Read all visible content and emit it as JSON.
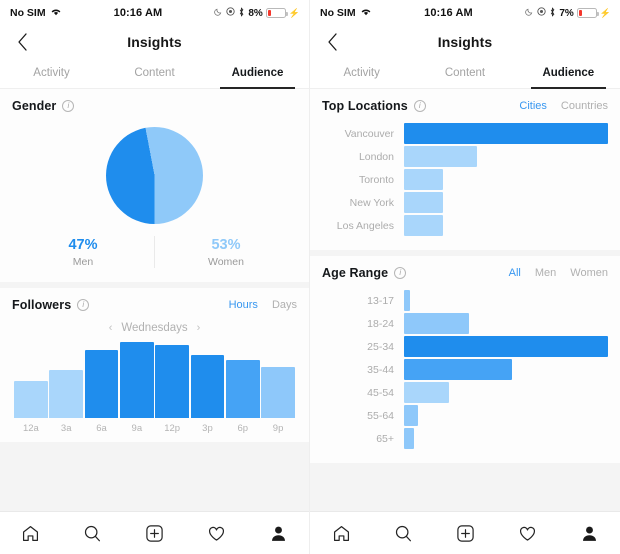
{
  "screens": [
    {
      "id": "left",
      "status": {
        "carrier": "No SIM",
        "wifi_icon": "wifi-icon",
        "time": "10:16 AM",
        "moon_icon": "moon-icon",
        "location_icon": "location-icon",
        "bluetooth_icon": "bluetooth-icon",
        "battery_percent": "8%",
        "charging_icon": "charging-bolt-icon"
      },
      "nav": {
        "back_icon": "back-chevron-icon",
        "title": "Insights"
      },
      "tabs": [
        {
          "label": "Activity",
          "active": false
        },
        {
          "label": "Content",
          "active": false
        },
        {
          "label": "Audience",
          "active": true
        }
      ],
      "cards": [
        "gender",
        "followers"
      ]
    },
    {
      "id": "right",
      "status": {
        "carrier": "No SIM",
        "wifi_icon": "wifi-icon",
        "time": "10:16 AM",
        "moon_icon": "moon-icon",
        "location_icon": "location-icon",
        "bluetooth_icon": "bluetooth-icon",
        "battery_percent": "7%",
        "charging_icon": "charging-bolt-icon"
      },
      "nav": {
        "back_icon": "back-chevron-icon",
        "title": "Insights"
      },
      "tabs": [
        {
          "label": "Activity",
          "active": false
        },
        {
          "label": "Content",
          "active": false
        },
        {
          "label": "Audience",
          "active": true
        }
      ],
      "cards": [
        "top_locations",
        "age_range"
      ]
    }
  ],
  "gender": {
    "title": "Gender",
    "info_icon": "info-icon",
    "men_pct": "47%",
    "men_label": "Men",
    "women_pct": "53%",
    "women_label": "Women"
  },
  "followers": {
    "title": "Followers",
    "info_icon": "info-icon",
    "segments": [
      {
        "label": "Hours",
        "active": true
      },
      {
        "label": "Days",
        "active": false
      }
    ],
    "day_prev_icon": "chevron-left-icon",
    "day_label": "Wednesdays",
    "day_next_icon": "chevron-right-icon"
  },
  "top_locations": {
    "title": "Top Locations",
    "info_icon": "info-icon",
    "segments": [
      {
        "label": "Cities",
        "active": true
      },
      {
        "label": "Countries",
        "active": false
      }
    ]
  },
  "age_range": {
    "title": "Age Range",
    "info_icon": "info-icon",
    "segments": [
      {
        "label": "All",
        "active": true
      },
      {
        "label": "Men",
        "active": false
      },
      {
        "label": "Women",
        "active": false
      }
    ]
  },
  "tabbar": [
    {
      "icon": "home-icon"
    },
    {
      "icon": "search-icon"
    },
    {
      "icon": "add-post-icon"
    },
    {
      "icon": "heart-icon"
    },
    {
      "icon": "profile-icon"
    }
  ],
  "colors": {
    "blue_dark": "#1f8ded",
    "blue_mid": "#45a3f5",
    "blue_light": "#a9d6fb",
    "blue_accent": "#3897f0",
    "gray_text": "#b0b0b0"
  },
  "chart_data": [
    {
      "type": "pie",
      "title": "Gender",
      "labels": [
        "Men",
        "Women"
      ],
      "values": [
        47,
        53
      ],
      "value_labels": [
        "47%",
        "53%"
      ],
      "colors": [
        "#1f8ded",
        "#8fc9f9"
      ],
      "legend": "below"
    },
    {
      "type": "bar",
      "title": "Followers",
      "subtitle": "Wednesdays",
      "categories": [
        "12a",
        "3a",
        "6a",
        "9a",
        "12p",
        "3p",
        "6p",
        "9p"
      ],
      "values": [
        42,
        55,
        78,
        88,
        84,
        72,
        67,
        58
      ],
      "bar_colors": [
        "#a9d6fb",
        "#a9d6fb",
        "#1f8ded",
        "#1f8ded",
        "#1f8ded",
        "#1f8ded",
        "#45a3f5",
        "#8ec8fa"
      ],
      "ylim": [
        0,
        100
      ],
      "grid": false,
      "xlabel": "",
      "ylabel": ""
    },
    {
      "type": "bar",
      "orientation": "horizontal",
      "title": "Top Locations",
      "categories": [
        "Vancouver",
        "London",
        "Toronto",
        "New York",
        "Los Angeles"
      ],
      "values": [
        100,
        36,
        19,
        19,
        19
      ],
      "bar_colors": [
        "#1f8ded",
        "#a9d6fb",
        "#a9d6fb",
        "#a9d6fb",
        "#a9d6fb"
      ],
      "xlim": [
        0,
        100
      ],
      "grid": false
    },
    {
      "type": "bar",
      "orientation": "horizontal",
      "title": "Age Range",
      "categories": [
        "13-17",
        "18-24",
        "25-34",
        "35-44",
        "45-54",
        "55-64",
        "65+"
      ],
      "values": [
        3,
        32,
        100,
        53,
        22,
        7,
        5
      ],
      "bar_colors": [
        "#8ec8fa",
        "#8ec8fa",
        "#1f8ded",
        "#45a3f5",
        "#a9d6fb",
        "#8ec8fa",
        "#8ec8fa"
      ],
      "xlim": [
        0,
        100
      ],
      "grid": false
    }
  ]
}
